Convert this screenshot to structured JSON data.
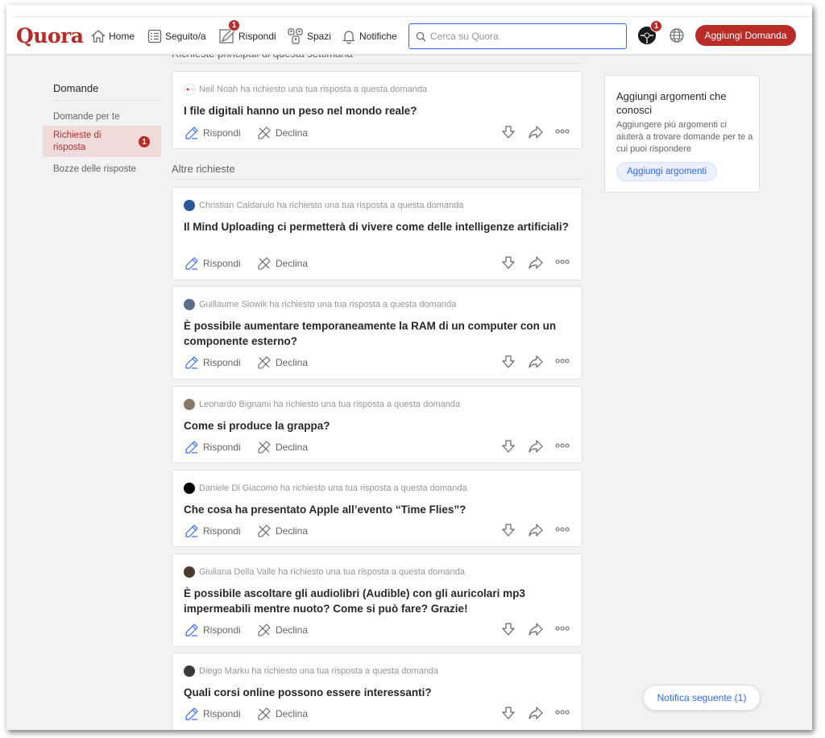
{
  "header": {
    "logo": "Quora",
    "nav": {
      "home": "Home",
      "following": "Seguito/a",
      "answer": "Rispondi",
      "answer_badge": "1",
      "spaces": "Spazi",
      "notifications": "Notifiche"
    },
    "search_placeholder": "Cerca su Quora",
    "profile_badge": "1",
    "add_question": "Aggiungi Domanda"
  },
  "sidebar": {
    "title": "Domande",
    "items": [
      {
        "label": "Domande per te"
      },
      {
        "label": "Richieste di risposta",
        "badge": "1"
      },
      {
        "label": "Bozze delle risposte"
      }
    ]
  },
  "main": {
    "section_top": "Richieste principali di questa settimana",
    "section_other": "Altre richieste",
    "actions": {
      "answer": "Rispondi",
      "decline": "Declina"
    },
    "top_request": {
      "meta": "Neil Noah ha richiesto una tua risposta a questa domanda",
      "question": "I file digitali hanno un peso nel mondo reale?"
    },
    "requests": [
      {
        "meta": "Christian Caldarulo ha richiesto una tua risposta a questa domanda",
        "question": "Il Mind Uploading ci permetterà di vivere come delle intelligenze artificiali?"
      },
      {
        "meta": "Guillaume Slowik ha richiesto una tua risposta a questa domanda",
        "question": "È possibile aumentare temporaneamente la RAM di un computer con un componente esterno?"
      },
      {
        "meta": "Leonardo Bignami ha richiesto una tua risposta a questa domanda",
        "question": "Come si produce la grappa?"
      },
      {
        "meta": "Daniele Di Giacomo ha richiesto una tua risposta a questa domanda",
        "question": "Che cosa ha presentato Apple all’evento “Time Flies”?"
      },
      {
        "meta": "Giuliana Della Valle ha richiesto una tua risposta a questa domanda",
        "question": "È possibile ascoltare gli audiolibri (Audible) con gli auricolari mp3 impermeabili mentre nuoto? Come si può fare? Grazie!"
      },
      {
        "meta": "Diego Marku ha richiesto una tua risposta a questa domanda",
        "question": "Quali corsi online possono essere interessanti?"
      }
    ]
  },
  "right_panel": {
    "title": "Aggiungi argomenti che conosci",
    "description": "Aggiungere più argomenti ci aiuterà a trovare domande per te a cui puoi rispondere",
    "button": "Aggiungi argomenti"
  },
  "next_notification": "Notifica seguente (1)",
  "colors": {
    "brand": "#b92b27",
    "link_blue": "#2e69ff",
    "background": "#f1f2f2"
  }
}
